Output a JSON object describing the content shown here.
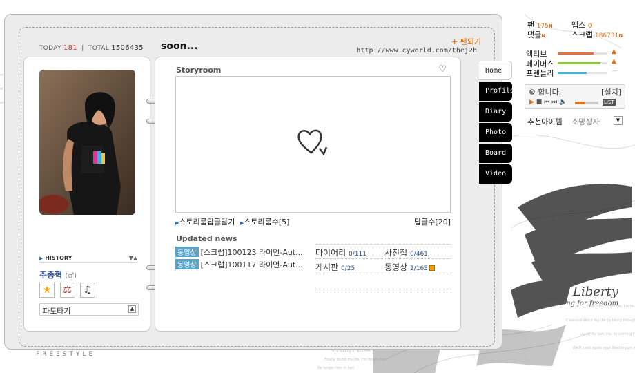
{
  "header": {
    "today_label": "TODAY",
    "today_count": "181",
    "total_label": "TOTAL",
    "total_count": "1506435",
    "title": "soon...",
    "fan_link": "+ 팬되기",
    "url": "http://www.cyworld.com/thej2h"
  },
  "profile": {
    "history_label": "HISTORY",
    "name": "주종혁",
    "gender": "(♂)",
    "surf_label": "파도타기"
  },
  "storyroom": {
    "title": "Storyroom",
    "link_reply": "스토리룸답글달기",
    "link_count": "스토리룸수[5]",
    "reply_count": "답글수[20]"
  },
  "updated_news": {
    "title": "Updated news",
    "items": [
      {
        "tag": "동영상",
        "text": "[스크랩]100123 라이언-Aut..."
      },
      {
        "tag": "동영상",
        "text": "[스크랩]100117 라이언-Aut..."
      }
    ]
  },
  "stats": {
    "diary_label": "다이어리",
    "diary_count": "0/111",
    "photo_label": "사진첩",
    "photo_count": "0/461",
    "board_label": "게시판",
    "board_count": "0/25",
    "video_label": "동영상",
    "video_count": "2/163"
  },
  "tabs": [
    "Home",
    "Profile",
    "Diary",
    "Photo",
    "Board",
    "Video"
  ],
  "widget": {
    "fan_label": "팬",
    "fan_value": "175",
    "apps_label": "앱스",
    "apps_value": "0",
    "comment_label": "댓글",
    "scrap_label": "스크랩",
    "scrap_value": "186731",
    "new_mark": "N",
    "bars": [
      {
        "label": "액티브",
        "level": 0.72,
        "color": "#e8703a"
      },
      {
        "label": "페이머스",
        "level": 0.86,
        "color": "#8dc63f"
      },
      {
        "label": "프렌들리",
        "level": 0.58,
        "color": "#3bb3d9"
      }
    ],
    "player_title": "합니다.",
    "player_setup": "[설치]",
    "player_list": "LIST",
    "recommend": "추천아이템",
    "wishlist": "소망상자"
  },
  "decor": {
    "freestyle": "FREESTYLE",
    "liberty": "Liberty",
    "freedom": "something for freedom"
  }
}
